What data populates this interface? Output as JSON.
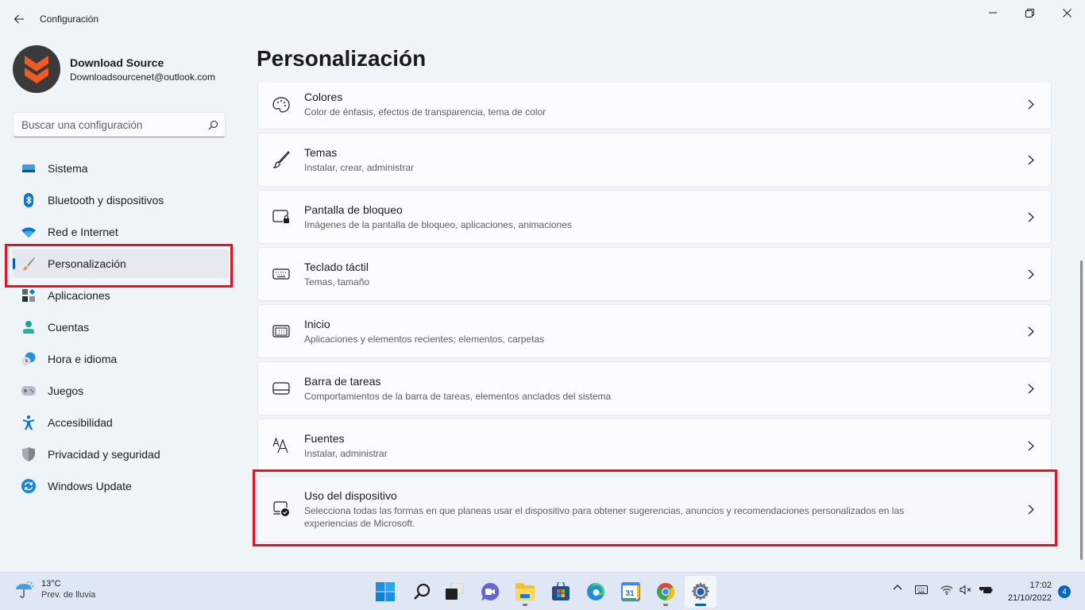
{
  "window": {
    "title": "Configuración",
    "controls": {
      "minimize": "minimize",
      "maximize": "restore",
      "close": "close"
    }
  },
  "profile": {
    "name": "Download Source",
    "email": "Downloadsourcenet@outlook.com"
  },
  "search": {
    "placeholder": "Buscar una configuración",
    "value": ""
  },
  "sidebar": {
    "items": [
      {
        "label": "Sistema",
        "icon": "system-icon",
        "active": false
      },
      {
        "label": "Bluetooth y dispositivos",
        "icon": "bluetooth-icon",
        "active": false
      },
      {
        "label": "Red e Internet",
        "icon": "wifi-icon",
        "active": false
      },
      {
        "label": "Personalización",
        "icon": "paintbrush-icon",
        "active": true
      },
      {
        "label": "Aplicaciones",
        "icon": "apps-icon",
        "active": false
      },
      {
        "label": "Cuentas",
        "icon": "account-icon",
        "active": false
      },
      {
        "label": "Hora e idioma",
        "icon": "time-language-icon",
        "active": false
      },
      {
        "label": "Juegos",
        "icon": "gamepad-icon",
        "active": false
      },
      {
        "label": "Accesibilidad",
        "icon": "accessibility-icon",
        "active": false
      },
      {
        "label": "Privacidad y seguridad",
        "icon": "shield-icon",
        "active": false
      },
      {
        "label": "Windows Update",
        "icon": "windows-update-icon",
        "active": false
      }
    ]
  },
  "main": {
    "title": "Personalización",
    "cards": [
      {
        "title": "Colores",
        "subtitle": "Color de énfasis, efectos de transparencia, tema de color",
        "icon": "palette-icon"
      },
      {
        "title": "Temas",
        "subtitle": "Instalar, crear, administrar",
        "icon": "brush-icon"
      },
      {
        "title": "Pantalla de bloqueo",
        "subtitle": "Imágenes de la pantalla de bloqueo, aplicaciones, animaciones",
        "icon": "lock-screen-icon"
      },
      {
        "title": "Teclado táctil",
        "subtitle": "Temas, tamaño",
        "icon": "keyboard-icon"
      },
      {
        "title": "Inicio",
        "subtitle": "Aplicaciones y elementos recientes; elementos, carpetas",
        "icon": "start-icon"
      },
      {
        "title": "Barra de tareas",
        "subtitle": "Comportamientos de la barra de tareas, elementos anclados del sistema",
        "icon": "taskbar-icon"
      },
      {
        "title": "Fuentes",
        "subtitle": "Instalar, administrar",
        "icon": "fonts-icon"
      },
      {
        "title": "Uso del dispositivo",
        "subtitle": "Selecciona todas las formas en que planeas usar el dispositivo para obtener sugerencias, anuncios y recomendaciones personalizados en las experiencias de Microsoft.",
        "icon": "device-usage-icon"
      }
    ]
  },
  "taskbar": {
    "weather": {
      "temp": "13°C",
      "desc": "Prev. de lluvia"
    },
    "apps": [
      {
        "name": "start",
        "running": false
      },
      {
        "name": "search",
        "running": false
      },
      {
        "name": "task-view",
        "running": false
      },
      {
        "name": "teams-chat",
        "running": false
      },
      {
        "name": "file-explorer",
        "running": true
      },
      {
        "name": "microsoft-store",
        "running": false
      },
      {
        "name": "edge",
        "running": false
      },
      {
        "name": "google-calendar",
        "running": false,
        "label": "31"
      },
      {
        "name": "chrome",
        "running": true
      },
      {
        "name": "settings",
        "running": true,
        "active": true
      }
    ],
    "clock": {
      "time": "17:02",
      "date": "21/10/2022"
    },
    "notifications": "4"
  },
  "colors": {
    "accent": "#005fb8",
    "highlight_red": "#e81123",
    "background": "#eff4f9",
    "card": "#fbfcfd"
  }
}
